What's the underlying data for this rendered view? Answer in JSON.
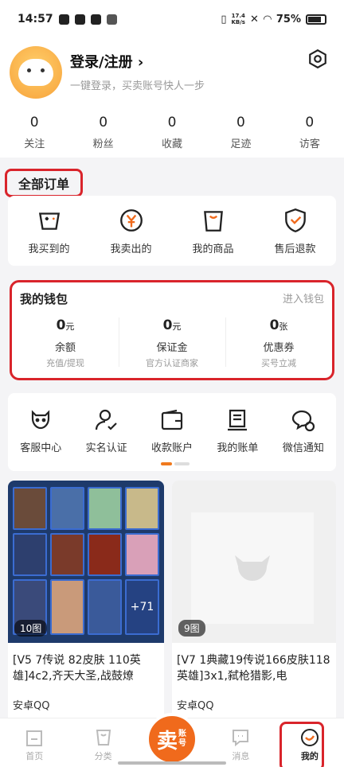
{
  "status_bar": {
    "time": "14:57",
    "speed": "17.4\nKB/s",
    "battery": "75%"
  },
  "profile": {
    "login_label": "登录/注册 ›",
    "subtitle": "一键登录，买卖账号快人一步",
    "stats": [
      {
        "num": "0",
        "label": "关注"
      },
      {
        "num": "0",
        "label": "粉丝"
      },
      {
        "num": "0",
        "label": "收藏"
      },
      {
        "num": "0",
        "label": "足迹"
      },
      {
        "num": "0",
        "label": "访客"
      }
    ]
  },
  "orders": {
    "title": "全部订单",
    "items": [
      {
        "label": "我买到的",
        "icon": "gamepad-icon"
      },
      {
        "label": "我卖出的",
        "icon": "yen-coin-icon"
      },
      {
        "label": "我的商品",
        "icon": "shopping-bag-icon"
      },
      {
        "label": "售后退款",
        "icon": "shield-check-icon"
      }
    ]
  },
  "wallet": {
    "title": "我的钱包",
    "link": "进入钱包",
    "cols": [
      {
        "amount": "0",
        "unit": "元",
        "name": "余额",
        "sub": "充值/提现"
      },
      {
        "amount": "0",
        "unit": "元",
        "name": "保证金",
        "sub": "官方认证商家"
      },
      {
        "amount": "0",
        "unit": "张",
        "name": "优惠券",
        "sub": "买号立减"
      }
    ]
  },
  "services": [
    {
      "label": "客服中心",
      "icon": "support-icon"
    },
    {
      "label": "实名认证",
      "icon": "user-verify-icon"
    },
    {
      "label": "收款账户",
      "icon": "wallet-icon"
    },
    {
      "label": "我的账单",
      "icon": "bill-icon"
    },
    {
      "label": "微信通知",
      "icon": "wechat-notify-icon"
    }
  ],
  "products": [
    {
      "img_count": "10图",
      "plus": "+71",
      "title": "[V5 7传说 82皮肤 110英雄]4c2,齐天大圣,战鼓燎",
      "game": "安卓QQ"
    },
    {
      "img_count": "9图",
      "title": "[V7 1典藏19传说166皮肤118英雄]3x1,弑枪猎影,电",
      "game": "安卓QQ"
    }
  ],
  "bottom_nav": {
    "items": [
      {
        "label": "首页"
      },
      {
        "label": "分类"
      },
      {
        "label": "消息"
      },
      {
        "label": "我的"
      }
    ],
    "sell_big": "卖",
    "sell_small": "账号"
  },
  "colors": {
    "accent": "#f06a1c",
    "highlight_border": "#d9242b"
  }
}
